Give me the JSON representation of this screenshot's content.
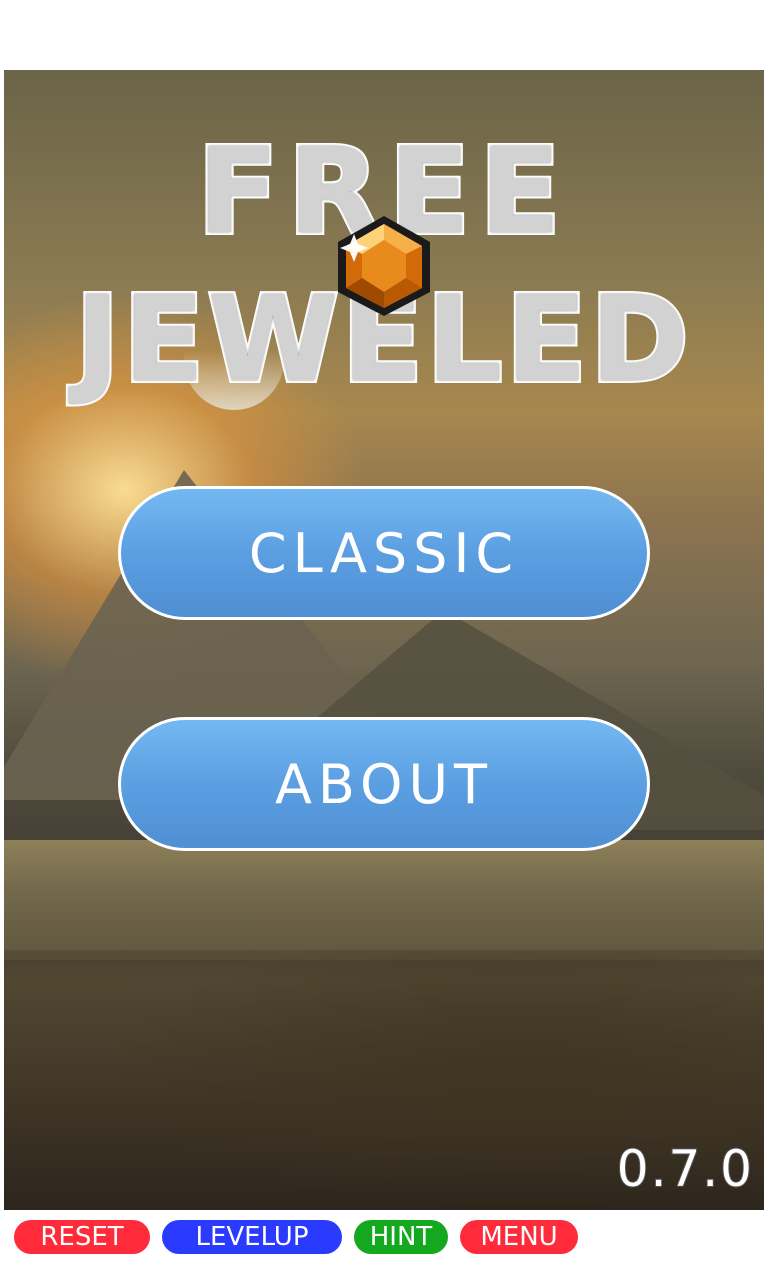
{
  "title": {
    "line1": "FREE",
    "line2": "JEWELED"
  },
  "menu": {
    "classic_label": "CLASSIC",
    "about_label": "ABOUT"
  },
  "version": "0.7.0",
  "debug_bar": {
    "reset_label": "RESET",
    "levelup_label": "LEVELUP",
    "hint_label": "HINT",
    "menu_label": "MENU"
  },
  "colors": {
    "button_blue": "#5b9fe2",
    "reset_red": "#ff2a3a",
    "levelup_blue": "#2a3aff",
    "hint_green": "#14a81f",
    "gem_orange": "#d26a08"
  },
  "icons": {
    "gem": "orange-hexagon-gem-icon"
  }
}
